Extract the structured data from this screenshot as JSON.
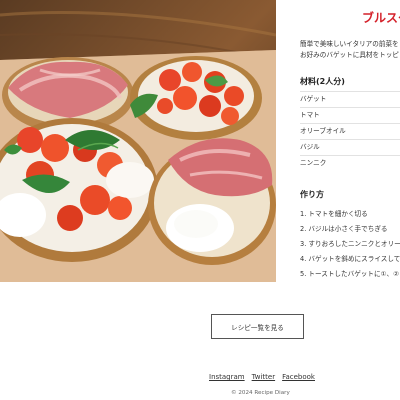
{
  "recipe": {
    "title": "ブルスケ",
    "description_lines": [
      "簡単で美味しいイタリアの前菜を",
      "お好みのバゲットに具材をトッピ"
    ],
    "photo_label": "bruschetta-photo"
  },
  "ingredients": {
    "heading": "材料(2人分)",
    "items": [
      "バゲット",
      "トマト",
      "オリーブオイル",
      "バジル",
      "ニンニク"
    ]
  },
  "method": {
    "heading": "作り方",
    "steps": [
      "1. トマトを細かく切る",
      "2. バジルは小さく手でちぎる",
      "3. すりおろしたニンニクとオリー",
      "4. バゲットを斜めにスライスして",
      "5. トーストしたバゲットに①、②"
    ]
  },
  "footer": {
    "back_button": "レシピ一覧を見る",
    "social_links": [
      "Instagram",
      "Twitter",
      "Facebook"
    ],
    "copyright": "© 2024 Recipe Diary"
  },
  "colors": {
    "accent": "#d4212a",
    "divider": "#e2e2e2"
  }
}
